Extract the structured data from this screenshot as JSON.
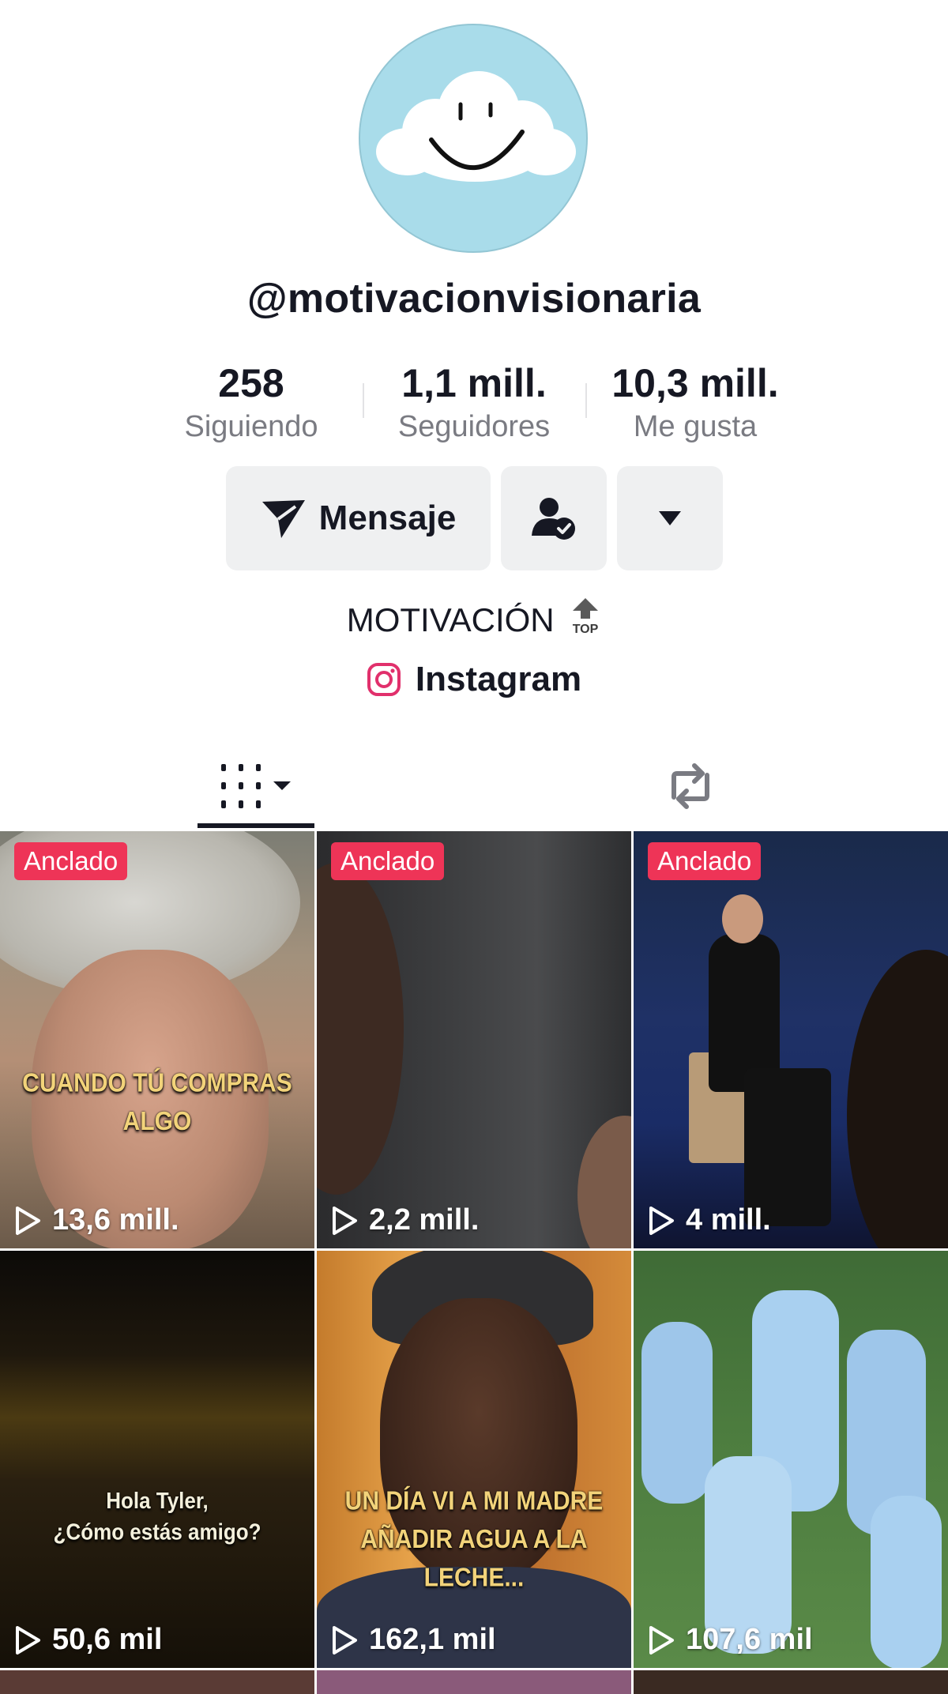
{
  "profile": {
    "username": "@motivacionvisionaria",
    "bio": "MOTIVACIÓN",
    "link_label": "Instagram"
  },
  "stats": [
    {
      "value": "258",
      "label": "Siguiendo"
    },
    {
      "value": "1,1 mill.",
      "label": "Seguidores"
    },
    {
      "value": "10,3 mill.",
      "label": "Me gusta"
    }
  ],
  "actions": {
    "message_label": "Mensaje"
  },
  "tabs": {
    "videos_icon": "grid-icon",
    "reposts_icon": "repost-icon"
  },
  "videos": [
    {
      "pinned_label": "Anclado",
      "views": "13,6 mill.",
      "caption": [
        "CUANDO TÚ COMPRAS",
        "ALGO"
      ]
    },
    {
      "pinned_label": "Anclado",
      "views": "2,2 mill."
    },
    {
      "pinned_label": "Anclado",
      "views": "4 mill."
    },
    {
      "views": "50,6 mil",
      "caption": [
        "Hola Tyler,",
        "¿Cómo estás amigo?"
      ]
    },
    {
      "views": "162,1 mil",
      "caption": [
        "UN DÍA VI A MI MADRE",
        "AÑADIR AGUA A LA LECHE..."
      ]
    },
    {
      "views": "107,6 mil"
    }
  ],
  "colors": {
    "pin_badge": "#ee3457",
    "button_bg": "#eff0f1",
    "avatar_bg": "#a9dcea"
  }
}
